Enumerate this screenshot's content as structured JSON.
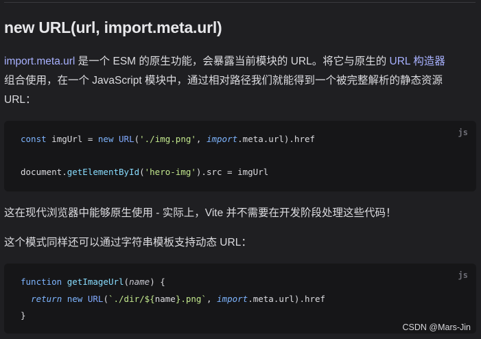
{
  "heading": "new URL(url, import.meta.url)",
  "intro": {
    "link1": "import.meta.url",
    "text1": " 是一个 ESM 的原生功能，会暴露当前模块的 URL。将它与原生的 ",
    "link2": "URL 构造器",
    "line2": "组合使用，在一个 JavaScript 模块中，通过相对路径我们就能得到一个被完整解析的静态资源",
    "line3": "URL："
  },
  "code_block_1": {
    "language": "js",
    "line1": {
      "t1": "const",
      "t2": " imgUrl = ",
      "t3": "new",
      "t4": " ",
      "t5": "URL",
      "t6": "(",
      "t7": "'./img.png'",
      "t8": ", ",
      "t9": "import",
      "t10": ".meta.url).href"
    },
    "line2": {
      "t1": "document.",
      "t2": "getElementById",
      "t3": "(",
      "t4": "'hero-img'",
      "t5": ").src = imgUrl"
    }
  },
  "para2": "这在现代浏览器中能够原生使用 - 实际上，Vite 并不需要在开发阶段处理这些代码！",
  "para3": "这个模式同样还可以通过字符串模板支持动态 URL：",
  "code_block_2": {
    "language": "js",
    "line1": {
      "t1": "function",
      "t2": " ",
      "t3": "getImageUrl",
      "t4": "(",
      "t5": "name",
      "t6": ") {"
    },
    "line2": {
      "t0": "  ",
      "t1": "return",
      "t2": " ",
      "t3": "new",
      "t4": " ",
      "t5": "URL",
      "t6": "(",
      "t7": "`./dir/${",
      "t8": "name",
      "t9": "}.png`",
      "t10": ", ",
      "t11": "import",
      "t12": ".meta.url).href"
    },
    "line3": "}"
  },
  "watermark": "CSDN @Mars-Jin"
}
